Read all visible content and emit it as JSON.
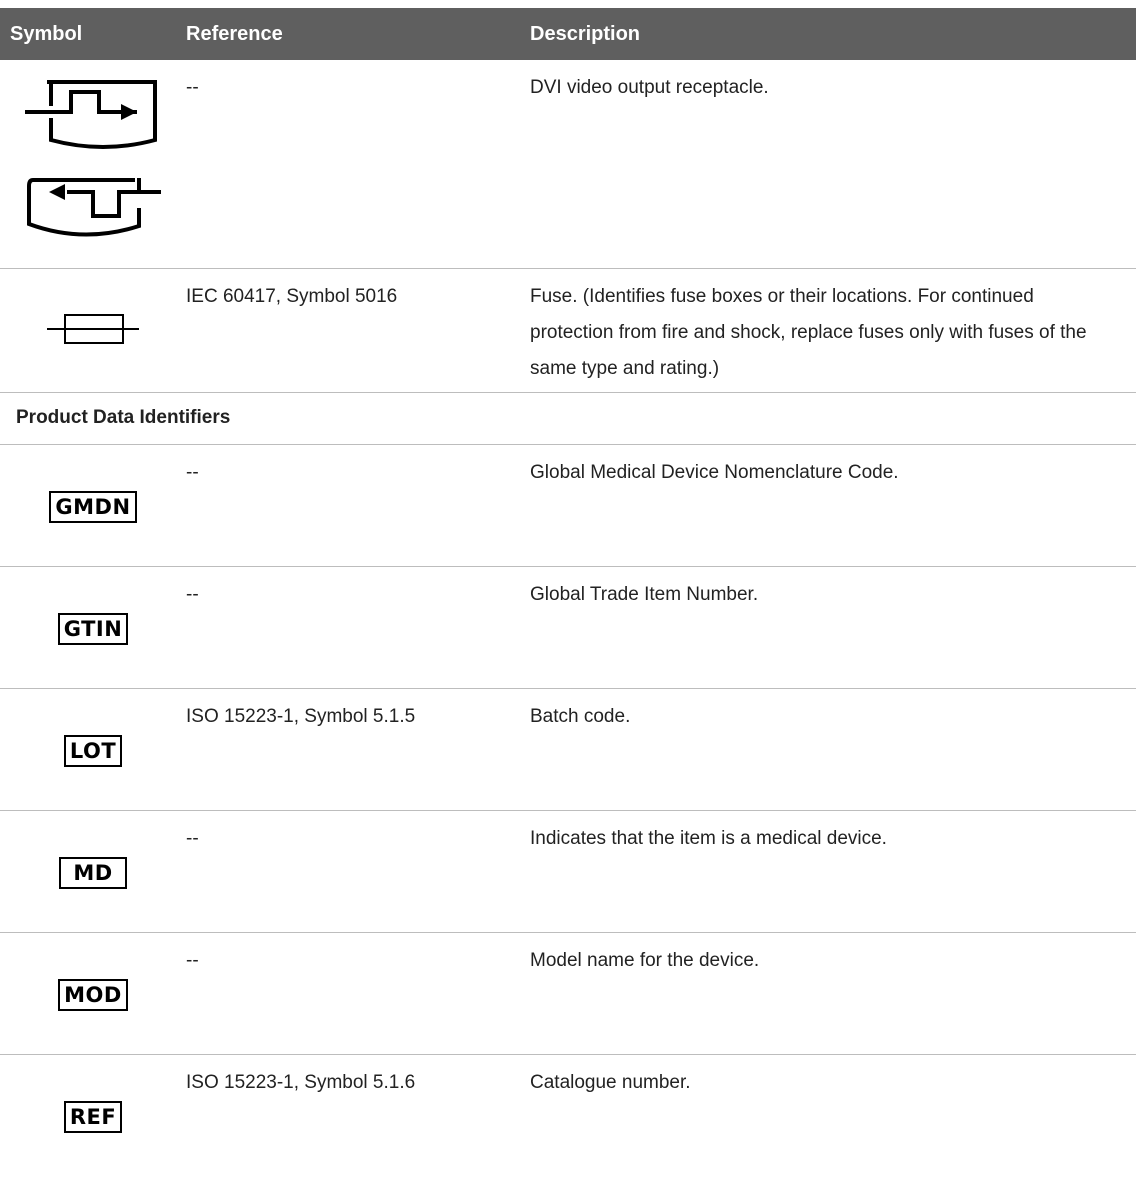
{
  "header": {
    "symbol": "Symbol",
    "reference": "Reference",
    "description": "Description"
  },
  "rows_top": [
    {
      "reference": "--",
      "description": "DVI video output receptacle."
    },
    {
      "reference": "IEC 60417, Symbol 5016",
      "description": "Fuse. (Identifies fuse boxes or their locations. For continued protection from fire and shock, replace fuses only with fuses of the same type and rating.)"
    }
  ],
  "section_title": "Product Data Identifiers",
  "rows": [
    {
      "symbol": "GMDN",
      "reference": "--",
      "description": "Global Medical Device Nomenclature Code."
    },
    {
      "symbol": "GTIN",
      "reference": "--",
      "description": "Global Trade Item Number."
    },
    {
      "symbol": "LOT",
      "reference": "ISO 15223-1, Symbol 5.1.5",
      "description": "Batch code."
    },
    {
      "symbol": "MD",
      "reference": "--",
      "description": "Indicates that the item is a medical device."
    },
    {
      "symbol": "MOD",
      "reference": "--",
      "description": "Model name for the device."
    },
    {
      "symbol": "REF",
      "reference": "ISO 15223-1, Symbol 5.1.6",
      "description": "Catalogue number."
    }
  ],
  "icons": {
    "row1": "dvi-output-icon",
    "row2": "fuse-icon"
  }
}
